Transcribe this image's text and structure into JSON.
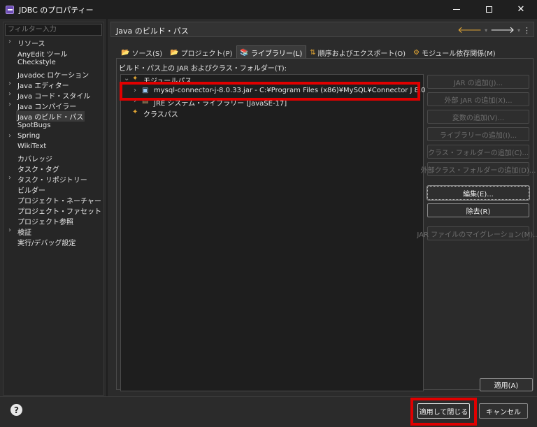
{
  "window": {
    "title": "JDBC のプロパティー"
  },
  "left": {
    "filter_placeholder": "フィルター入力",
    "items": [
      {
        "label": "リソース",
        "expandable": true
      },
      {
        "label": "AnyEdit ツール",
        "expandable": false
      },
      {
        "label": "Checkstyle",
        "expandable": false
      },
      {
        "label": "Javadoc ロケーション",
        "expandable": false
      },
      {
        "label": "Java エディター",
        "expandable": true
      },
      {
        "label": "Java コード・スタイル",
        "expandable": true
      },
      {
        "label": "Java コンパイラー",
        "expandable": true
      },
      {
        "label": "Java のビルド・パス",
        "expandable": false,
        "selected": true
      },
      {
        "label": "SpotBugs",
        "expandable": false
      },
      {
        "label": "Spring",
        "expandable": true
      },
      {
        "label": "WikiText",
        "expandable": false
      },
      {
        "label": "カバレッジ",
        "expandable": false
      },
      {
        "label": "タスク・タグ",
        "expandable": false
      },
      {
        "label": "タスク・リポジトリー",
        "expandable": true
      },
      {
        "label": "ビルダー",
        "expandable": false
      },
      {
        "label": "プロジェクト・ネーチャー",
        "expandable": false
      },
      {
        "label": "プロジェクト・ファセット",
        "expandable": false
      },
      {
        "label": "プロジェクト参照",
        "expandable": false
      },
      {
        "label": "検証",
        "expandable": true
      },
      {
        "label": "実行/デバッグ設定",
        "expandable": false
      }
    ]
  },
  "page": {
    "title": "Java のビルド・パス",
    "tabs": [
      {
        "label": "ソース(S)",
        "icon": "source-folder-icon"
      },
      {
        "label": "プロジェクト(P)",
        "icon": "project-folder-icon"
      },
      {
        "label": "ライブラリー(L)",
        "icon": "library-icon",
        "active": true
      },
      {
        "label": "順序およびエクスポート(O)",
        "icon": "order-export-icon"
      },
      {
        "label": "モジュール依存関係(M)",
        "icon": "module-dependency-icon"
      }
    ],
    "build_path_label": "ビルド・パス上の JAR およびクラス・フォルダー(T):",
    "tree": {
      "module_path": "モジュールパス",
      "jar_entry": "mysql-connector-j-8.0.33.jar - C:¥Program Files (x86)¥MySQL¥Connector J 8.0",
      "jre_entry": "JRE システム・ライブラリー [JavaSE-17]",
      "class_path": "クラスパス"
    },
    "side_buttons": [
      {
        "label": "JAR の追加(J)...",
        "enabled": false
      },
      {
        "label": "外部 JAR の追加(X)...",
        "enabled": false
      },
      {
        "label": "変数の追加(V)...",
        "enabled": false
      },
      {
        "label": "ライブラリーの追加(I)...",
        "enabled": false
      },
      {
        "label": "クラス・フォルダーの追加(C)...",
        "enabled": false
      },
      {
        "label": "外部クラス・フォルダーの追加(D)...",
        "enabled": false
      },
      {
        "label": "編集(E)...",
        "enabled": true
      },
      {
        "label": "除去(R)",
        "enabled": true
      },
      {
        "label": "JAR ファイルのマイグレーション(M)...",
        "enabled": false
      }
    ],
    "apply_label": "適用(A)"
  },
  "footer": {
    "apply_close_label": "適用して閉じる",
    "cancel_label": "キャンセル"
  },
  "colors": {
    "highlight": "#e00000",
    "background": "#2b2b2b",
    "list_background": "#1e1e1e"
  }
}
